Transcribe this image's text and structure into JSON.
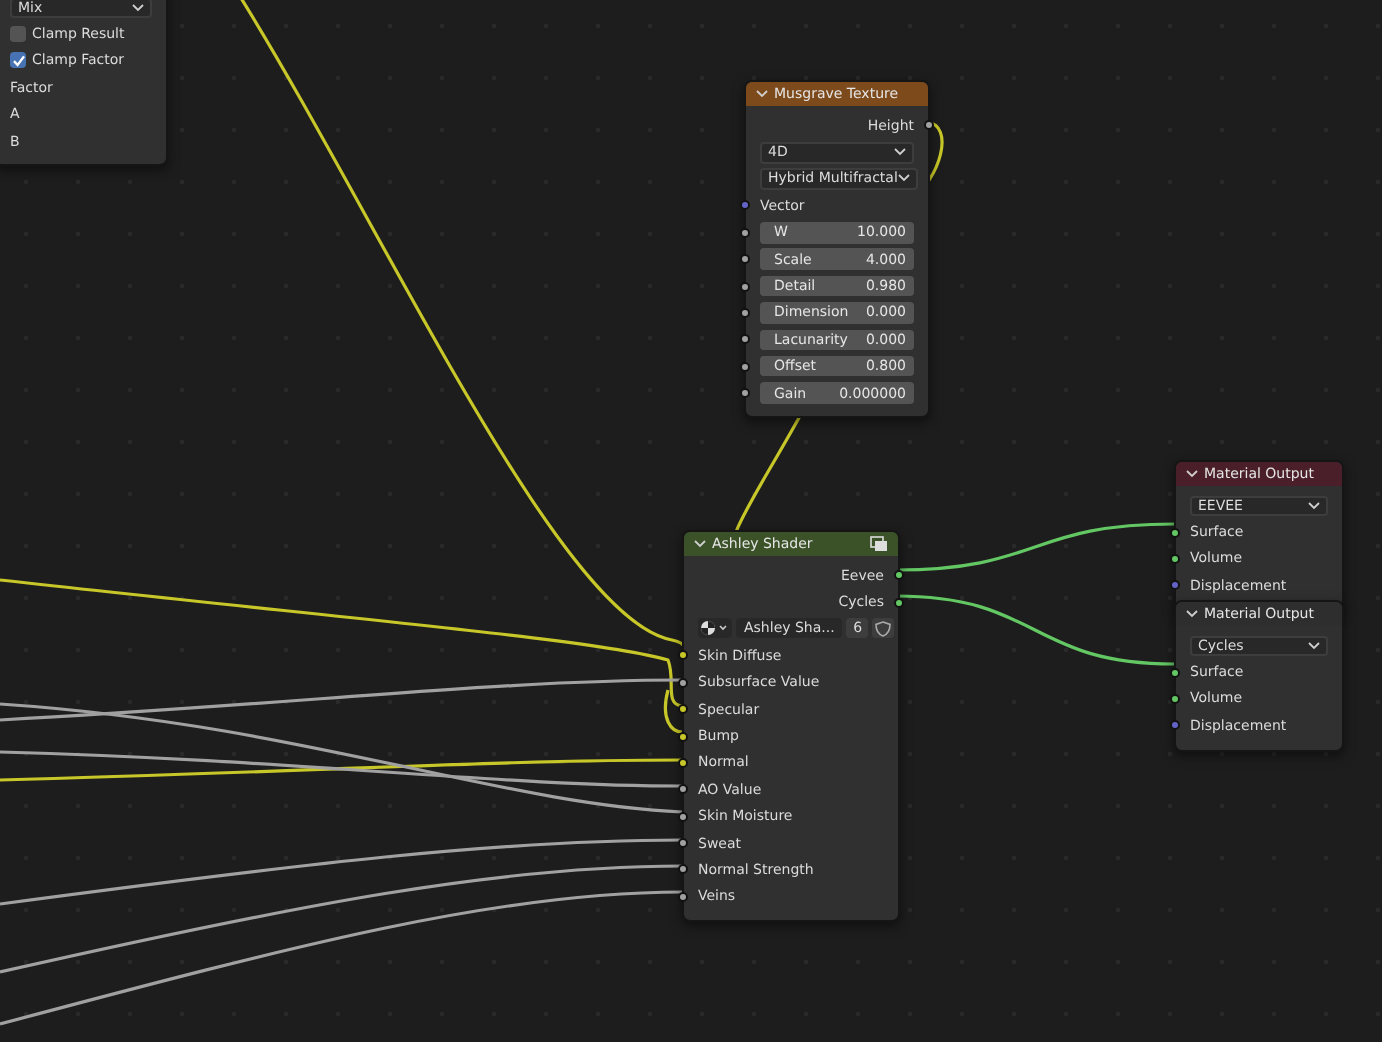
{
  "nodes": [
    {
      "kind": "partial",
      "rows": [
        {
          "kind": "dropdown",
          "value": "Mix"
        },
        {
          "kind": "checkbox",
          "label": "Clamp Result",
          "checked": false
        },
        {
          "kind": "checkbox",
          "label": "Clamp Factor",
          "checked": true
        },
        {
          "kind": "label",
          "label": "Factor"
        },
        {
          "kind": "label",
          "label": "A"
        },
        {
          "kind": "label",
          "label": "B"
        }
      ]
    },
    {
      "kind": "node",
      "title": "Musgrave Texture",
      "color": "#7d4a1c",
      "rows": [
        {
          "kind": "output",
          "label": "Height",
          "color": "#a1a1a1"
        },
        {
          "kind": "dropdown",
          "value": "4D"
        },
        {
          "kind": "dropdown",
          "value": "Hybrid Multifractal"
        },
        {
          "kind": "input",
          "label": "Vector",
          "color": "#6363c7"
        },
        {
          "kind": "field",
          "label": "W",
          "value": "10.000",
          "color": "#a1a1a1"
        },
        {
          "kind": "field",
          "label": "Scale",
          "value": "4.000",
          "color": "#a1a1a1"
        },
        {
          "kind": "field",
          "label": "Detail",
          "value": "0.980",
          "color": "#a1a1a1"
        },
        {
          "kind": "field",
          "label": "Dimension",
          "value": "0.000",
          "color": "#a1a1a1"
        },
        {
          "kind": "field",
          "label": "Lacunarity",
          "value": "0.000",
          "color": "#a1a1a1"
        },
        {
          "kind": "field",
          "label": "Offset",
          "value": "0.800",
          "color": "#a1a1a1"
        },
        {
          "kind": "field",
          "label": "Gain",
          "value": "0.000000",
          "color": "#a1a1a1"
        }
      ]
    },
    {
      "kind": "group",
      "title": "Ashley Shader",
      "color": "#3b5228",
      "rows": [
        {
          "kind": "output",
          "label": "Eevee",
          "color": "#63c763"
        },
        {
          "kind": "output",
          "label": "Cycles",
          "color": "#63c763"
        },
        {
          "kind": "datablock",
          "value": "Ashley Sha...",
          "users": "6"
        },
        {
          "kind": "input",
          "label": "Skin Diffuse",
          "color": "#c7c729"
        },
        {
          "kind": "input",
          "label": "Subsurface Value",
          "color": "#a1a1a1"
        },
        {
          "kind": "input",
          "label": "Specular",
          "color": "#c7c729"
        },
        {
          "kind": "input",
          "label": "Bump",
          "color": "#c7c729"
        },
        {
          "kind": "input",
          "label": "Normal",
          "color": "#c7c729"
        },
        {
          "kind": "input",
          "label": "AO Value",
          "color": "#a1a1a1"
        },
        {
          "kind": "input",
          "label": "Skin Moisture",
          "color": "#a1a1a1"
        },
        {
          "kind": "input",
          "label": "Sweat",
          "color": "#a1a1a1"
        },
        {
          "kind": "input",
          "label": "Normal Strength",
          "color": "#a1a1a1"
        },
        {
          "kind": "input",
          "label": "Veins",
          "color": "#a1a1a1"
        }
      ]
    },
    {
      "kind": "node",
      "title": "Material Output",
      "color": "#4a1f29",
      "rows": [
        {
          "kind": "dropdown",
          "value": "EEVEE"
        },
        {
          "kind": "input",
          "label": "Surface",
          "color": "#63c763"
        },
        {
          "kind": "input",
          "label": "Volume",
          "color": "#63c763"
        },
        {
          "kind": "input",
          "label": "Displacement",
          "color": "#6363c7"
        }
      ]
    },
    {
      "kind": "node",
      "title": "Material Output",
      "color": "#2e2e2e",
      "rows": [
        {
          "kind": "dropdown",
          "value": "Cycles"
        },
        {
          "kind": "input",
          "label": "Surface",
          "color": "#63c763"
        },
        {
          "kind": "input",
          "label": "Volume",
          "color": "#63c763"
        },
        {
          "kind": "input",
          "label": "Displacement",
          "color": "#6363c7"
        }
      ]
    }
  ]
}
